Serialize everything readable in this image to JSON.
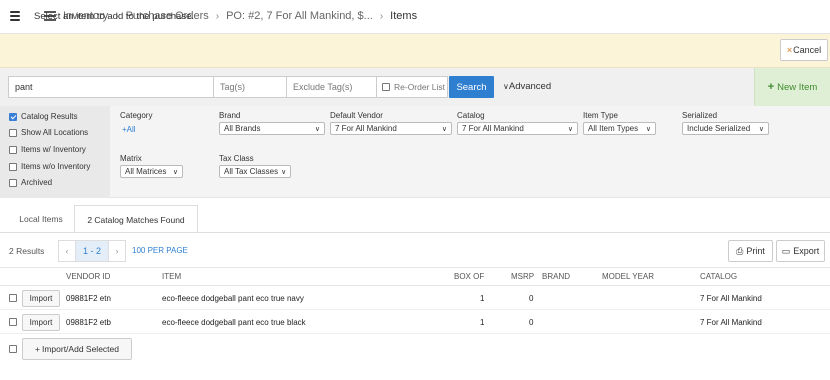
{
  "breadcrumb": {
    "items": [
      "Inventory",
      "Purchase Orders",
      "PO: #2, 7 For All Mankind, $..."
    ],
    "current": "Items"
  },
  "notice": {
    "text": "Select an item to add to the purchase."
  },
  "actions": {
    "cancel": "Cancel",
    "new_item": "New Item"
  },
  "search": {
    "query": "pant",
    "tags_placeholder": "Tag(s)",
    "exclude_placeholder": "Exclude Tag(s)",
    "reorder_label": "Re-Order List",
    "search_label": "Search",
    "advanced_label": "Advanced"
  },
  "options": [
    {
      "label": "Catalog Results",
      "checked": true
    },
    {
      "label": "Show All Locations",
      "checked": false
    },
    {
      "label": "Items w/ Inventory",
      "checked": false
    },
    {
      "label": "Items w/o Inventory",
      "checked": false
    },
    {
      "label": "Archived",
      "checked": false
    }
  ],
  "filters": {
    "category": {
      "label": "Category",
      "value": "All"
    },
    "brand": {
      "label": "Brand",
      "value": "All Brands"
    },
    "vendor": {
      "label": "Default Vendor",
      "value": "7 For All Mankind"
    },
    "catalog": {
      "label": "Catalog",
      "value": "7 For All Mankind"
    },
    "item_type": {
      "label": "Item Type",
      "value": "All Item Types"
    },
    "serialized": {
      "label": "Serialized",
      "value": "Include Serialized"
    },
    "matrix": {
      "label": "Matrix",
      "value": "All Matrices"
    },
    "tax_class": {
      "label": "Tax Class",
      "value": "All Tax Classes"
    }
  },
  "tabs": [
    "Local Items",
    "2 Catalog Matches Found"
  ],
  "results": {
    "count": "2 Results",
    "range": "1 - 2",
    "per_page": "100 PER PAGE",
    "print": "Print",
    "export": "Export"
  },
  "table": {
    "headers": [
      "VENDOR ID",
      "ITEM",
      "BOX OF",
      "MSRP",
      "BRAND",
      "MODEL YEAR",
      "CATALOG"
    ],
    "import_label": "Import",
    "rows": [
      {
        "vendor_id": "09881F2 etn",
        "item": "eco-fleece dodgeball pant eco true navy",
        "box_of": "1",
        "msrp": "0",
        "brand": "",
        "model_year": "",
        "catalog": "7 For All Mankind"
      },
      {
        "vendor_id": "09881F2 etb",
        "item": "eco-fleece dodgeball pant eco true black",
        "box_of": "1",
        "msrp": "0",
        "brand": "",
        "model_year": "",
        "catalog": "7 For All Mankind"
      }
    ],
    "bulk_label": "Import/Add Selected"
  },
  "colors": {
    "accent": "#2f7fd1",
    "notice_bg": "#fcf4d8",
    "new_item": "#3f8c2e"
  }
}
